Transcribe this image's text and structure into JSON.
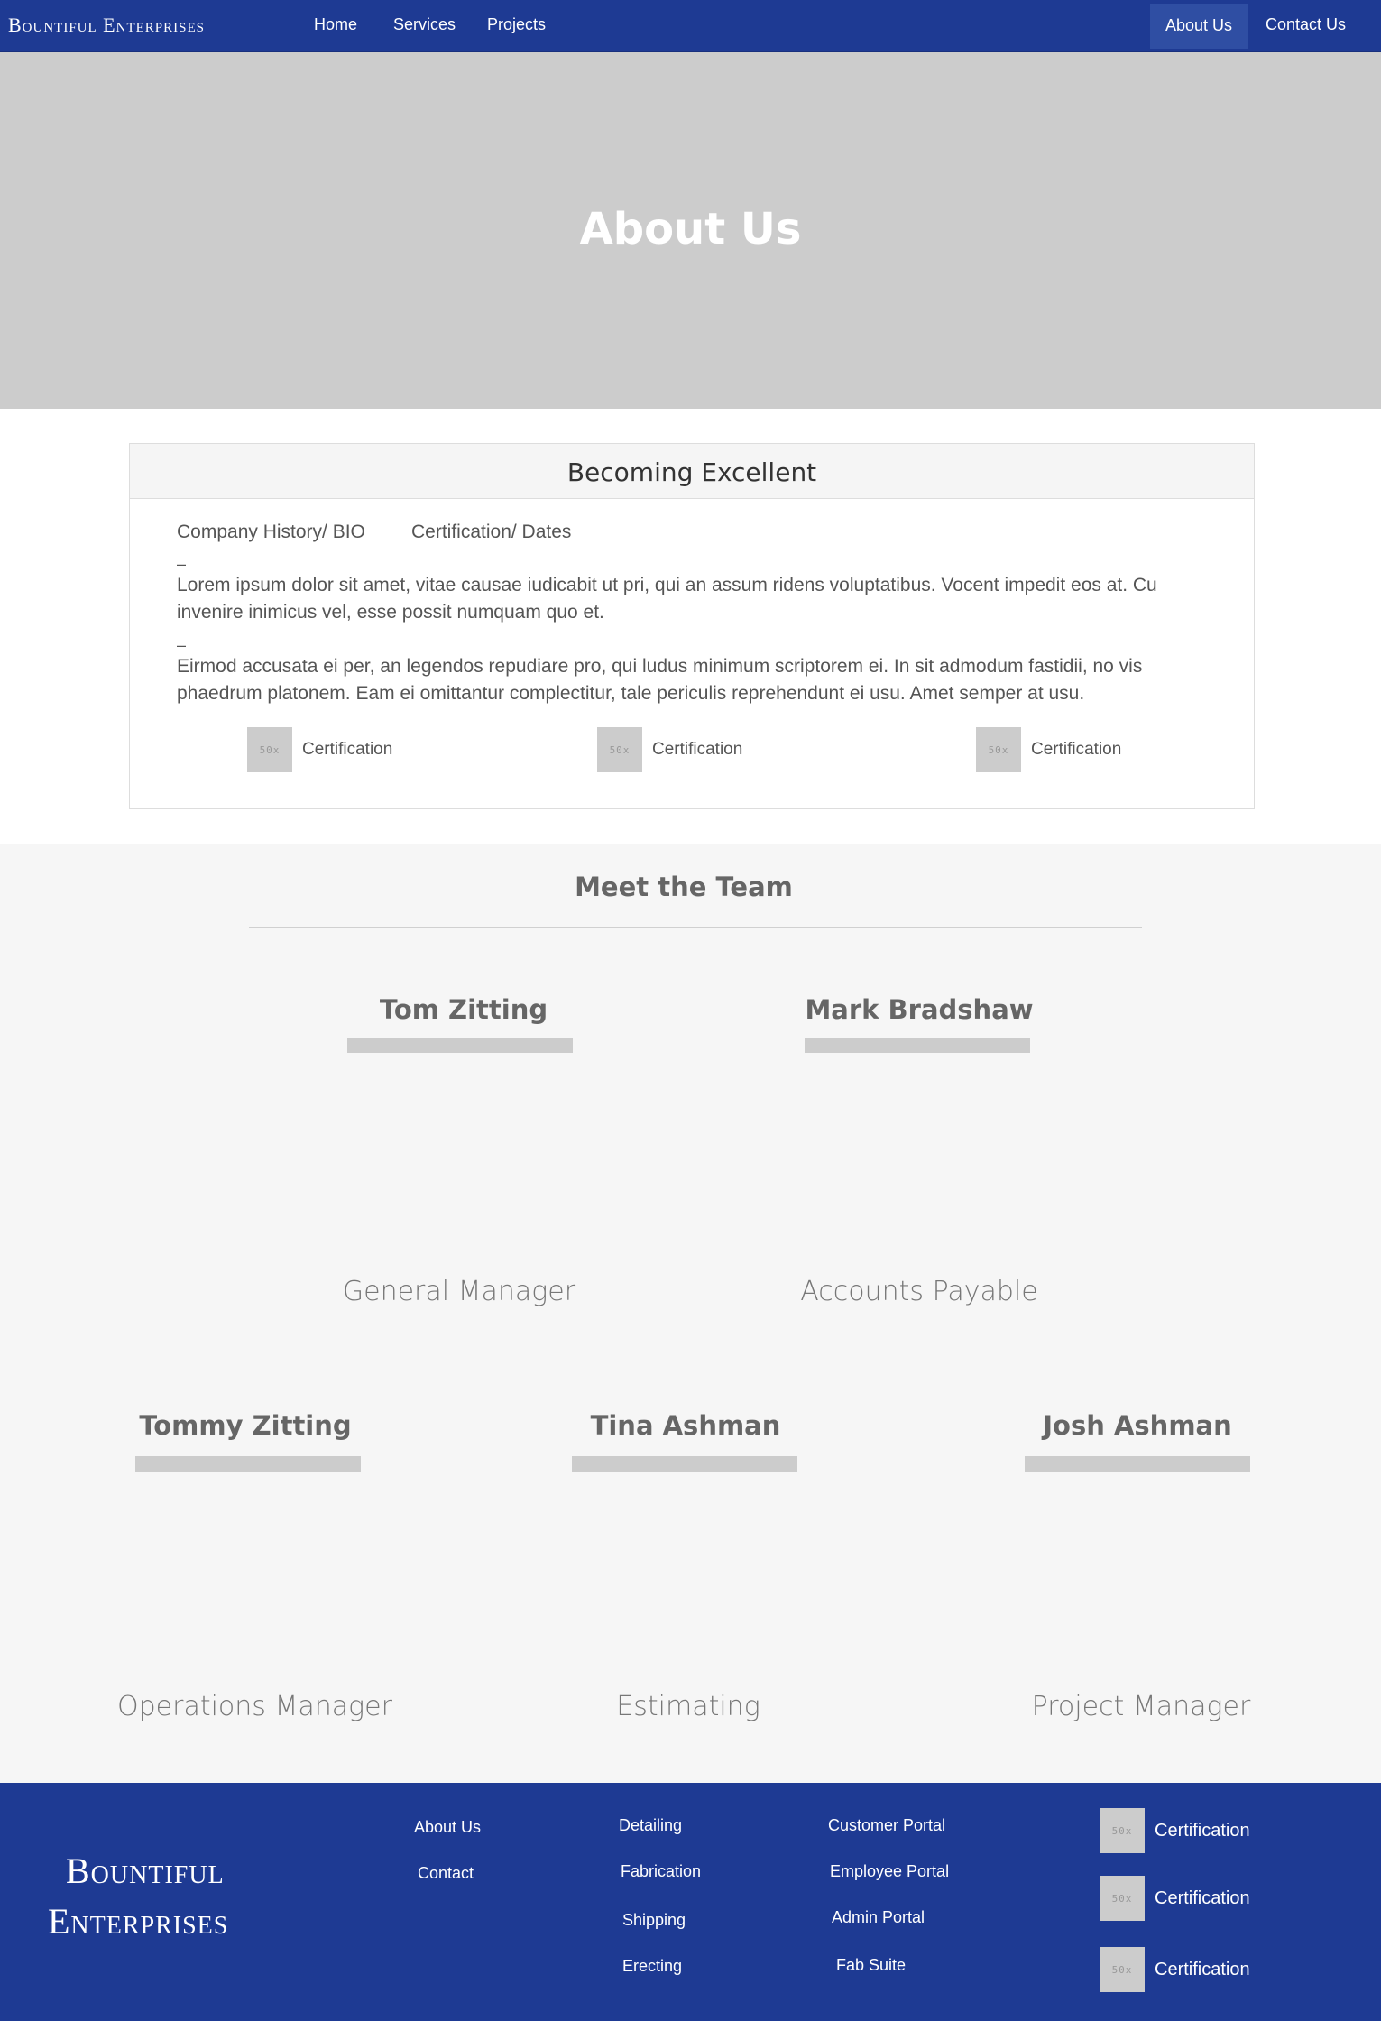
{
  "nav": {
    "brand": "Bountiful Enterprises",
    "links": [
      "Home",
      "Services",
      "Projects"
    ],
    "right_links": [
      "About Us",
      "Contact Us"
    ],
    "active": "About Us",
    "bg_color": "#1e3a93"
  },
  "hero": {
    "title": "About Us",
    "bg_color": "#cccccc"
  },
  "card": {
    "heading": "Becoming Excellent",
    "tabs": [
      "Company History/ BIO",
      "Certification/ Dates"
    ],
    "paragraphs": [
      {
        "dash": "–",
        "text": "Lorem ipsum dolor sit amet, vitae causae iudicabit ut pri, qui an assum ridens voluptatibus. Vocent impedit eos at. Cu invenire inimicus vel, esse possit numquam quo et."
      },
      {
        "dash": "–",
        "text": "Eirmod accusata ei per, an legendos repudiare pro, qui ludus minimum scriptorem ei. In sit admodum fastidii, no vis phaedrum platonem. Eam ei omittantur complectitur, tale periculis reprehendunt ei usu. Amet semper at usu."
      }
    ],
    "certifications": [
      {
        "thumb": "50x",
        "label": "Certification"
      },
      {
        "thumb": "50x",
        "label": "Certification"
      },
      {
        "thumb": "50x",
        "label": "Certification"
      }
    ]
  },
  "team": {
    "title": "Meet the Team",
    "members": [
      {
        "name": "Tom Zitting",
        "role": "General Manager"
      },
      {
        "name": "Mark Bradshaw",
        "role": "Accounts Payable"
      },
      {
        "name": "Tommy Zitting",
        "role": "Operations Manager"
      },
      {
        "name": "Tina Ashman",
        "role": "Estimating"
      },
      {
        "name": "Josh Ashman",
        "role": "Project Manager"
      }
    ]
  },
  "footer": {
    "brand_line1": "Bountiful",
    "brand_line2": "Enterprises",
    "col1": [
      "About Us",
      "Contact"
    ],
    "col2": [
      "Detailing",
      "Fabrication",
      "Shipping",
      "Erecting"
    ],
    "col3": [
      "Customer Portal",
      "Employee Portal",
      "Admin Portal",
      "Fab Suite"
    ],
    "certifications": [
      {
        "thumb": "50x",
        "label": "Certification"
      },
      {
        "thumb": "50x",
        "label": "Certification"
      },
      {
        "thumb": "50x",
        "label": "Certification"
      }
    ]
  }
}
